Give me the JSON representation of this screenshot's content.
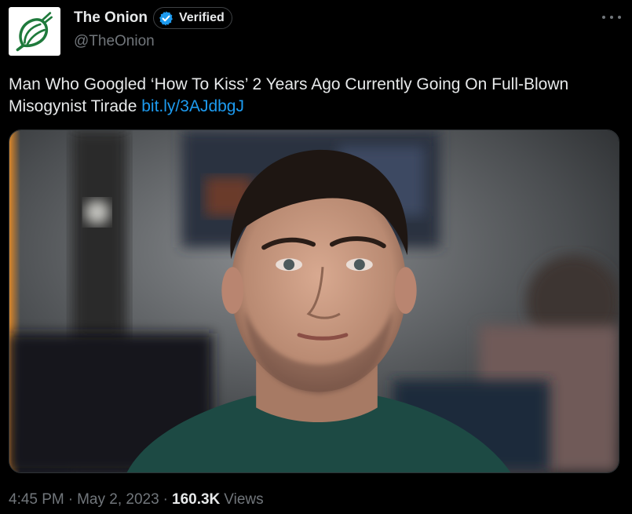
{
  "author": {
    "display_name": "The Onion",
    "handle": "@TheOnion",
    "verified_label": "Verified",
    "avatar_icon": "onion-logo-icon",
    "verified_icon": "verified-badge-icon"
  },
  "tweet": {
    "text": "Man Who Googled ‘How To Kiss’ 2 Years Ago Currently Going On Full-Blown Misogynist Tirade",
    "link": "bit.ly/3AJdbgJ"
  },
  "meta": {
    "time": "4:45 PM",
    "date": "May 2, 2023",
    "views_count": "160.3K",
    "views_label": "Views",
    "separator": "·"
  },
  "colors": {
    "background": "#000000",
    "text": "#e7e9ea",
    "muted": "#71767b",
    "link": "#1d9bf0",
    "onion_green": "#1f7a3c",
    "verified_blue": "#1d9bf0"
  },
  "icons": {
    "more": "more-options-icon"
  }
}
